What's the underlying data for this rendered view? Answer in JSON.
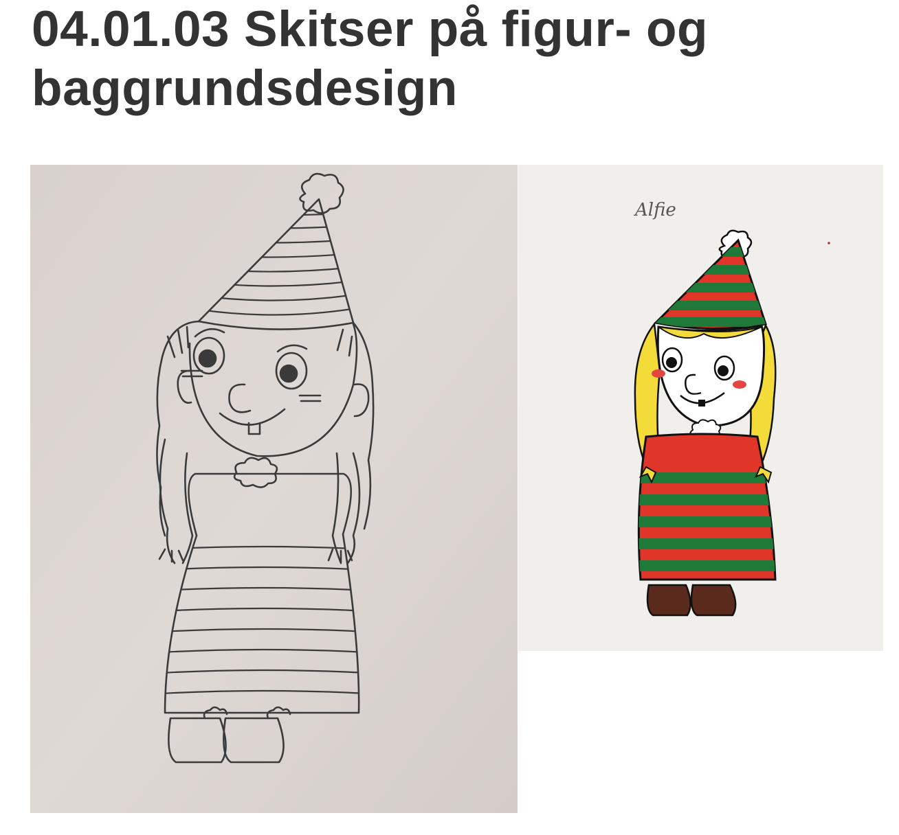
{
  "page": {
    "title": "04.01.03 Skitser på figur- og baggrundsdesign"
  },
  "gallery": {
    "colored_drawing": {
      "signature": "Alfie"
    }
  },
  "colors": {
    "title_text": "#333333",
    "sketch_paper": "#dcd6d2",
    "colored_paper": "#f1efec",
    "red": "#e0362a",
    "green": "#1f7a3a",
    "yellow": "#f3dc3a",
    "brown": "#5a2a1c"
  }
}
